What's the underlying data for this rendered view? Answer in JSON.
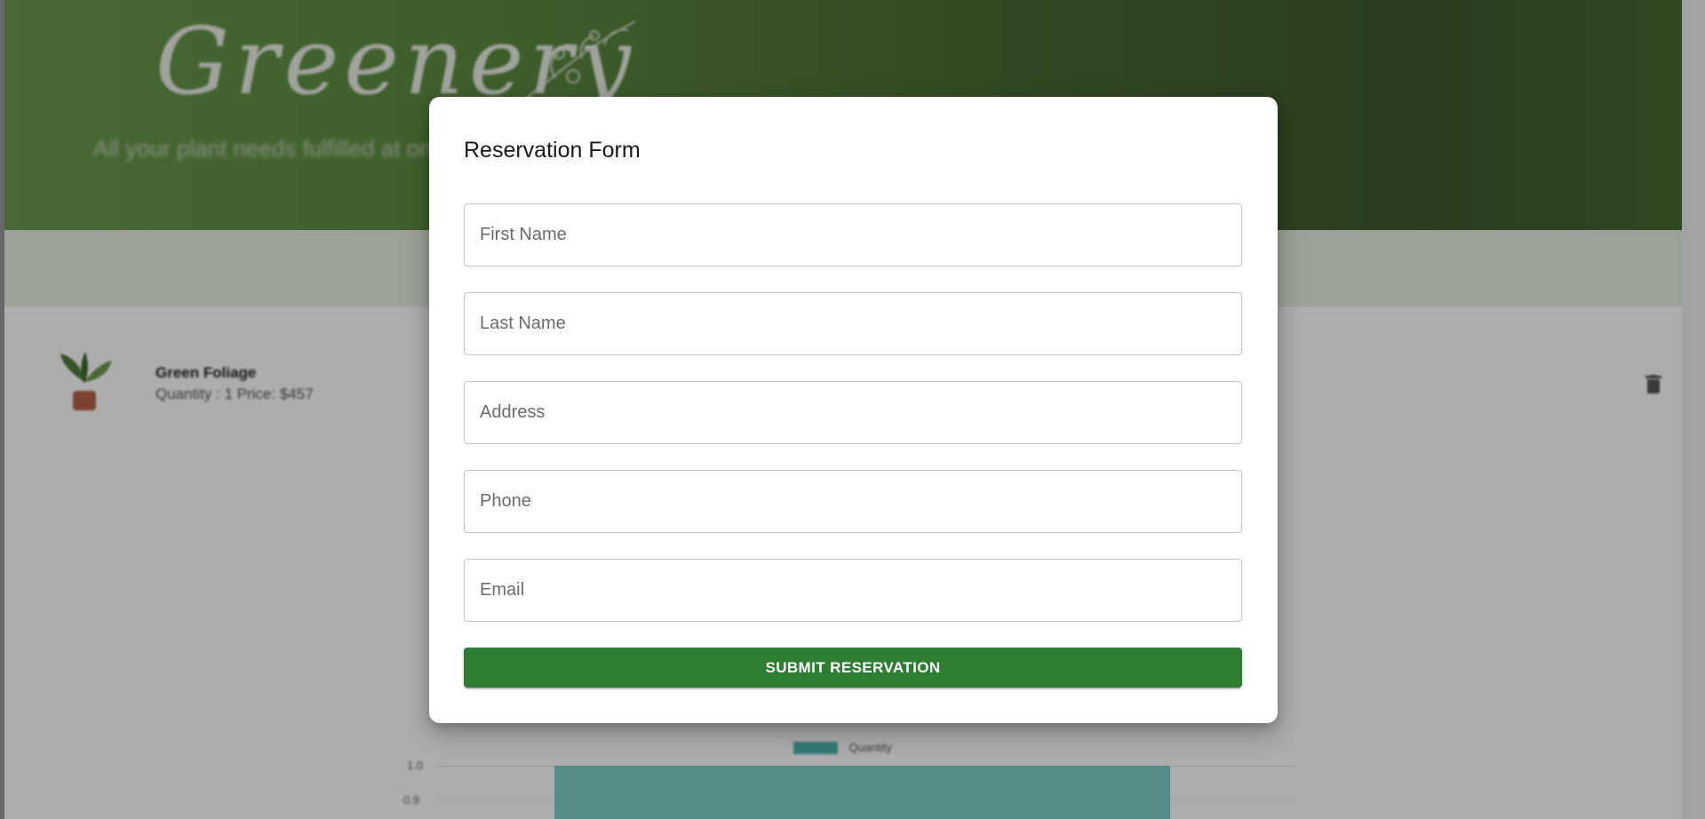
{
  "hero": {
    "logo_text": "Greenery",
    "tagline": "All your plant needs fulfilled at one place"
  },
  "cart": {
    "item_name": "Green Foliage",
    "item_meta": "Quantity : 1  Price: $457",
    "delete_icon": "trash-icon"
  },
  "chart": {
    "legend_label": "Quantity",
    "ticks": [
      "1.0",
      "0.9"
    ]
  },
  "modal": {
    "title": "Reservation Form",
    "fields": {
      "first_name": "First Name",
      "last_name": "Last Name",
      "address": "Address",
      "phone": "Phone",
      "email": "Email"
    },
    "submit_label": "SUBMIT RESERVATION"
  },
  "colors": {
    "primary": "#2e7d32",
    "hero_green": "#4a6b35",
    "chart_bar": "#4db6ac"
  }
}
